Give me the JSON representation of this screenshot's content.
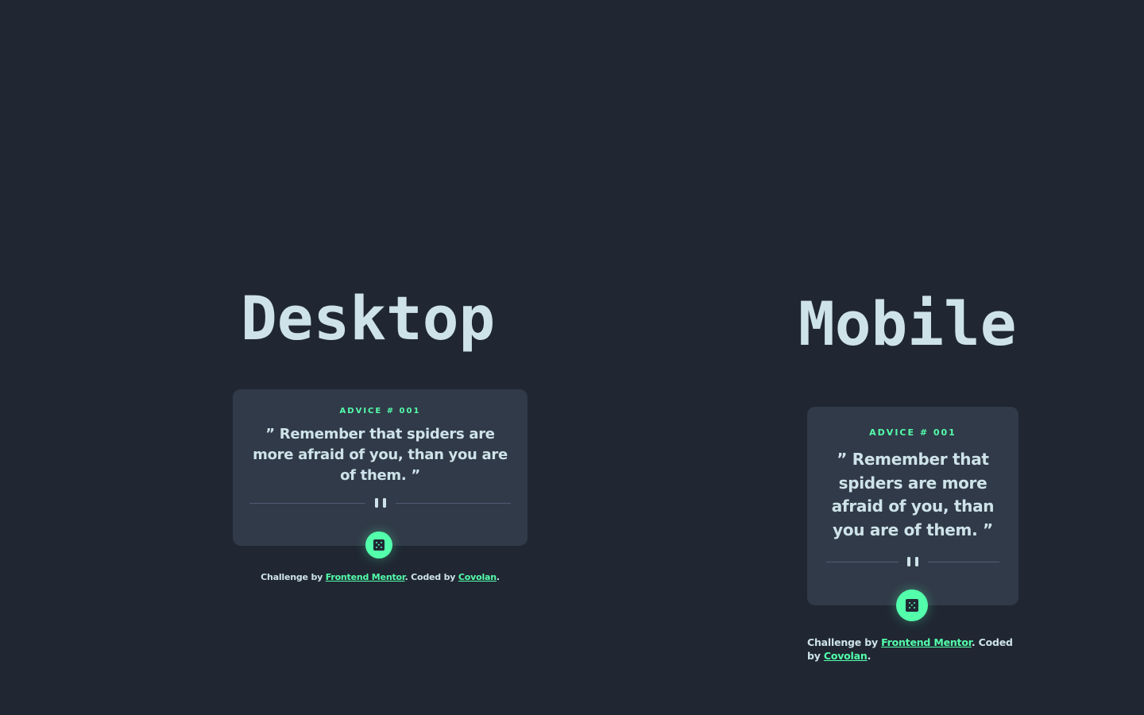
{
  "desktop": {
    "heading": "Desktop",
    "card": {
      "advice_label": "ADVICE # 001",
      "quote": "” Remember that spiders are more afraid of you, than you are of them. ”"
    },
    "attribution": {
      "prefix": "Challenge by ",
      "link1": "Frontend Mentor",
      "middle": ". Coded by ",
      "link2": "Covolan",
      "suffix": "."
    }
  },
  "mobile": {
    "heading": "Mobile",
    "card": {
      "advice_label": "ADVICE # 001",
      "quote": "” Remember that spiders are more afraid of you, than you are of them. ”"
    },
    "attribution": {
      "prefix": "Challenge by ",
      "link1": "Frontend Mentor",
      "middle": ". Coded by ",
      "link2": "Covolan",
      "suffix": "."
    }
  },
  "icons": {
    "divider_icon": "pause-icon",
    "button_icon": "dice-icon"
  },
  "colors": {
    "background": "#202733",
    "card": "#313a48",
    "accent": "#53ffab",
    "text": "#cee3e9",
    "divider": "#4f5d74"
  }
}
